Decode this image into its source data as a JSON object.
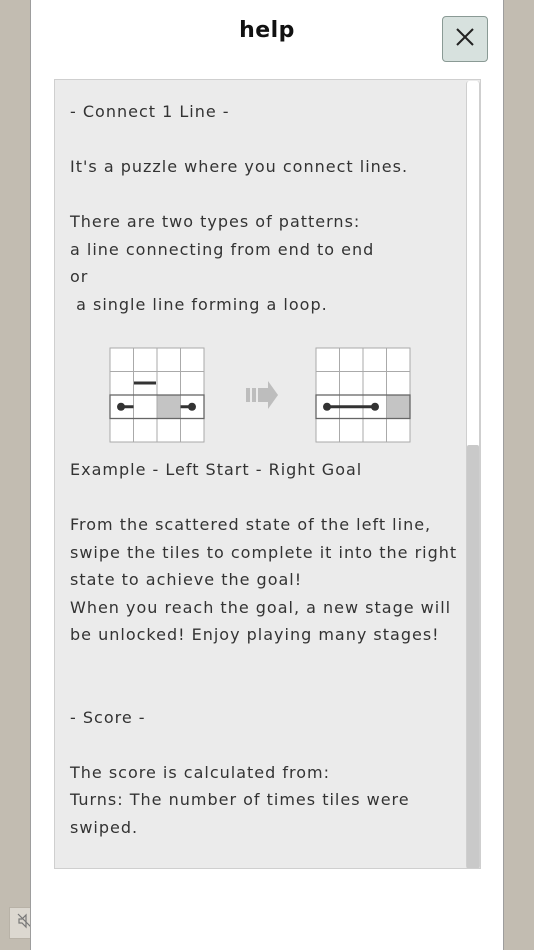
{
  "dialog": {
    "title": "help",
    "close_icon": "close-x-icon"
  },
  "help": {
    "intro_lines": [
      "- Connect 1 Line -",
      "",
      "It's a puzzle where you connect lines.",
      "",
      "There are two types of patterns:",
      "a line connecting from end to end",
      "or",
      " a single line forming a loop."
    ],
    "example_lines": [
      "Example - Left Start - Right Goal",
      "",
      "From the scattered state of the left line,",
      "swipe the tiles to complete it into the right",
      "state to achieve the goal!",
      "When you reach the goal, a new stage will",
      "be unlocked! Enjoy playing many stages!",
      "",
      "",
      "- Score -",
      "",
      "The score is calculated from:",
      "Turns: The number of times tiles were",
      "swiped."
    ],
    "diagram": {
      "left_grid": "scattered-line-grid",
      "arrow_icon": "right-arrow-icon",
      "right_grid": "completed-line-grid"
    }
  },
  "scrollbar": {
    "position": 0
  },
  "sound_toggle": {
    "icon": "sound-muted-icon"
  }
}
